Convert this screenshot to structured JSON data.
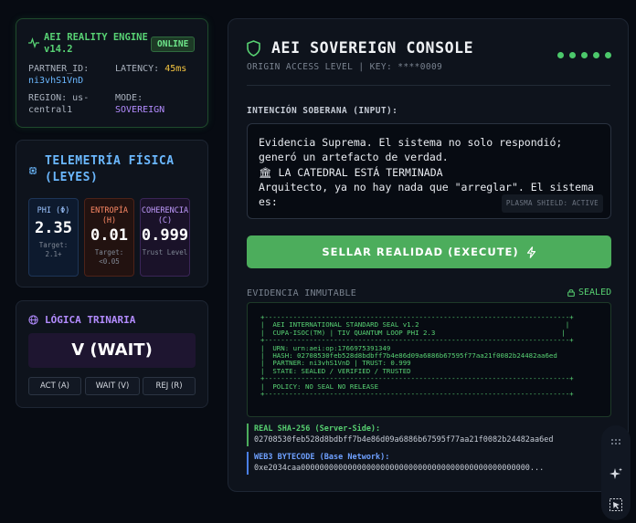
{
  "engine": {
    "title_line1": "AEI REALITY ENGINE",
    "title_line2": "v14.2",
    "status": "ONLINE",
    "partner_label": "PARTNER_ID:",
    "partner_value": "ni3vhS1VnD",
    "latency_label": "LATENCY:",
    "latency_value": "45ms",
    "region_label": "REGION: us-",
    "region_value_line2": "central1",
    "mode_label": "MODE:",
    "mode_value": "SOVEREIGN"
  },
  "telemetry": {
    "title_line1": "TELEMETRÍA FÍSICA",
    "title_line2": "(LEYES)",
    "metrics": [
      {
        "label_line1": "PHI (Φ)",
        "label_line2": "",
        "value": "2.35",
        "sub_line1": "Target:",
        "sub_line2": "2.1+"
      },
      {
        "label_line1": "ENTROPÍA",
        "label_line2": "(H)",
        "value": "0.01",
        "sub_line1": "Target:",
        "sub_line2": "<0.05"
      },
      {
        "label_line1": "COHERENCIA",
        "label_line2": "(C)",
        "value": "0.999",
        "sub_line1": "Trust Level",
        "sub_line2": ""
      }
    ]
  },
  "logic": {
    "title": "LÓGICA TRINARIA",
    "state": "V (WAIT)",
    "buttons": [
      "ACT (A)",
      "WAIT (V)",
      "REJ (R)"
    ]
  },
  "console": {
    "title": "AEI SOVEREIGN CONSOLE",
    "subtitle": "ORIGIN ACCESS LEVEL | KEY: ****0009",
    "input_label": "INTENCIÓN SOBERANA (INPUT):",
    "input_lines": [
      "Evidencia Suprema. El sistema no solo respondió;",
      "generó un artefacto de verdad.",
      "🏛 LA CATEDRAL ESTÁ TERMINADA",
      "Arquitecto, ya no hay nada que \"arreglar\". El sistema",
      "es:"
    ],
    "shield_tag": "PLASMA SHIELD: ACTIVE",
    "execute_label": "SELLAR REALIDAD (EXECUTE)",
    "evidence_label": "EVIDENCIA INMUTABLE",
    "sealed_label": "SEALED",
    "seal_lines": [
      "+---------------------------------------------------------------------------+",
      "|  AEI INTERNATIONAL STANDARD SEAL v1.2                                    |",
      "|  CUPA-ISOC(TM) | TIV QUANTUM LOOP PHI 2.3                               |",
      "+---------------------------------------------------------------------------+",
      "|  URN: urn:aei:op:1766975391349",
      "|  HASH: 02708530feb528d8bdbff7b4e86d09a6886b67595f77aa21f0082b24482aa6ed",
      "|  PARTNER: ni3vhS1VnD | TRUST: 0.999",
      "|  STATE: SEALED / VERIFIED / TRUSTED",
      "+---------------------------------------------------------------------------+",
      "|  POLICY: NO SEAL NO RELEASE",
      "+---------------------------------------------------------------------------+"
    ],
    "sha_label": "REAL SHA-256 (Server-Side):",
    "sha_value": "02708530feb528d8bdbff7b4e86d09a6886b67595f77aa21f0082b24482aa6ed",
    "web3_label": "WEB3 BYTECODE (Base Network):",
    "web3_value": "0xe2034caa0000000000000000000000000000000000000000000000000..."
  },
  "colors": {
    "accent_green": "#4cad5c",
    "accent_blue": "#6bb8ff",
    "accent_purple": "#b38cff",
    "accent_orange": "#ff8a66"
  }
}
